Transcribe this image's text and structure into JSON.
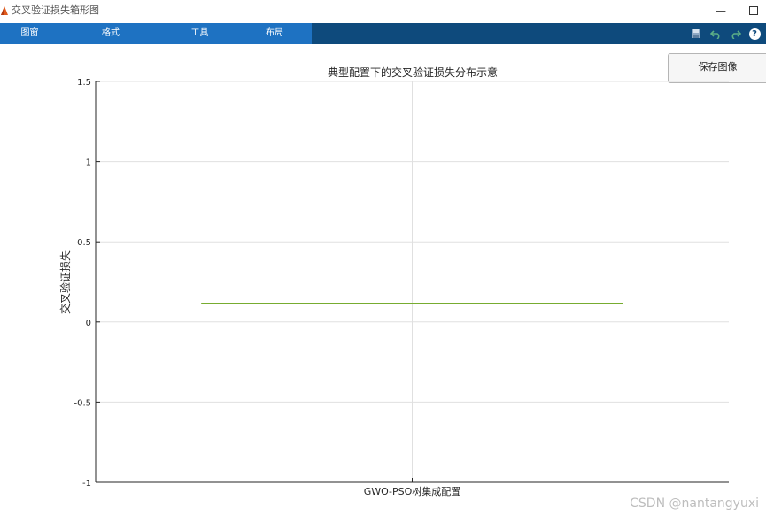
{
  "window": {
    "title": "交叉验证损失箱形图",
    "minimize_label": "—"
  },
  "toolstrip": {
    "tabs": [
      "图窗",
      "格式",
      "工具",
      "布局"
    ],
    "tools": [
      "save-icon",
      "undo-icon",
      "redo-icon",
      "help-icon"
    ],
    "help_label": "?"
  },
  "save_button": {
    "label": "保存图像"
  },
  "colors": {
    "toolstrip": "#0e4a7c",
    "tab_strip": "#1e72c2",
    "median_line": "#77ac30",
    "grid": "#e0e0e0"
  },
  "chart_data": {
    "type": "box",
    "title": "典型配置下的交叉验证损失分布示意",
    "xlabel": "",
    "ylabel": "交叉验证损失",
    "categories": [
      "GWO-PSO树集成配置"
    ],
    "yticks": [
      "1.5",
      "1",
      "0.5",
      "0",
      "-0.5",
      "-1"
    ],
    "ylim": [
      -1,
      1.5
    ],
    "median": 0.117,
    "grid": true
  },
  "watermark": "CSDN @nantangyuxi"
}
